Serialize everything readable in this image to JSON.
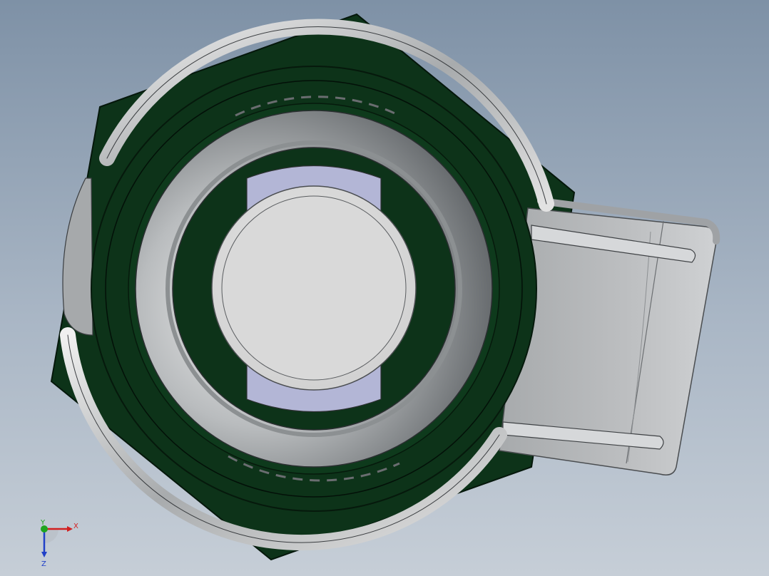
{
  "viewport": {
    "background_top": "#7e91a6",
    "background_bottom": "#c6ced7"
  },
  "model": {
    "body_color": "#0d3319",
    "metal_light": "#e6e6e6",
    "metal_dark": "#5e6264",
    "center_disc_color": "#d8d8d8",
    "clip_color": "#b3b6d6"
  },
  "triad": {
    "x_label": "X",
    "y_label": "Y",
    "z_label": "Z",
    "x_color": "#d22020",
    "y_color": "#1ea51e",
    "z_color": "#2040c8"
  }
}
